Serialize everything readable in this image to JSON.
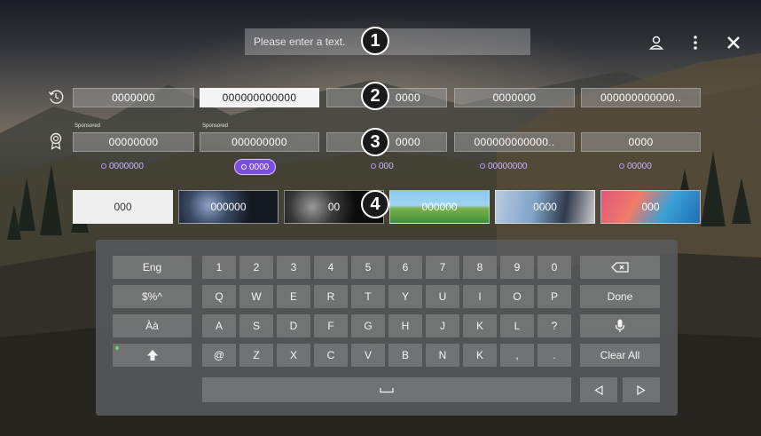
{
  "search": {
    "placeholder": "Please enter a text."
  },
  "top_actions": {
    "profile_icon": "person-icon",
    "menu_icon": "more-vertical-icon",
    "close_icon": "close-icon"
  },
  "callouts": [
    "1",
    "2",
    "3",
    "4"
  ],
  "recent": {
    "icon": "history-clock-icon",
    "items": [
      "0000000",
      "000000000000",
      "0000",
      "0000000",
      "000000000000.."
    ]
  },
  "recommended": {
    "icon": "badge-icon",
    "items": [
      {
        "sponsored": "Sponsored",
        "label": "00000000",
        "sub": "0000000"
      },
      {
        "sponsored": "Sponsored",
        "label": "000000000",
        "sub": "0000"
      },
      {
        "sponsored": "",
        "label": "0000",
        "sub": "000"
      },
      {
        "sponsored": "",
        "label": "000000000000..",
        "sub": "00000000"
      },
      {
        "sponsored": "",
        "label": "0000",
        "sub": "00000"
      }
    ]
  },
  "content_tiles": [
    "000",
    "000000",
    "00",
    "000000",
    "0000",
    "000"
  ],
  "keyboard": {
    "left_keys": [
      "Eng",
      "$%^",
      "Àà",
      "shift-up-arrow-icon"
    ],
    "rows": [
      [
        "1",
        "2",
        "3",
        "4",
        "5",
        "6",
        "7",
        "8",
        "9",
        "0"
      ],
      [
        "Q",
        "W",
        "E",
        "R",
        "T",
        "Y",
        "U",
        "I",
        "O",
        "P"
      ],
      [
        "A",
        "S",
        "D",
        "F",
        "G",
        "H",
        "J",
        "K",
        "L",
        "?"
      ],
      [
        "@",
        "Z",
        "X",
        "C",
        "V",
        "B",
        "N",
        "K",
        ",",
        "."
      ]
    ],
    "right_keys": {
      "backspace": "backspace-icon",
      "done": "Done",
      "voice": "microphone-icon",
      "clear": "Clear All"
    },
    "space_icon": "space-bar-icon",
    "cursor_left_icon": "triangle-left-icon",
    "cursor_right_icon": "triangle-right-icon",
    "indicator_color": "#5fd86a"
  },
  "colors": {
    "accent_purple": "#7a4ee0",
    "sub_text": "#c9b8ff"
  }
}
